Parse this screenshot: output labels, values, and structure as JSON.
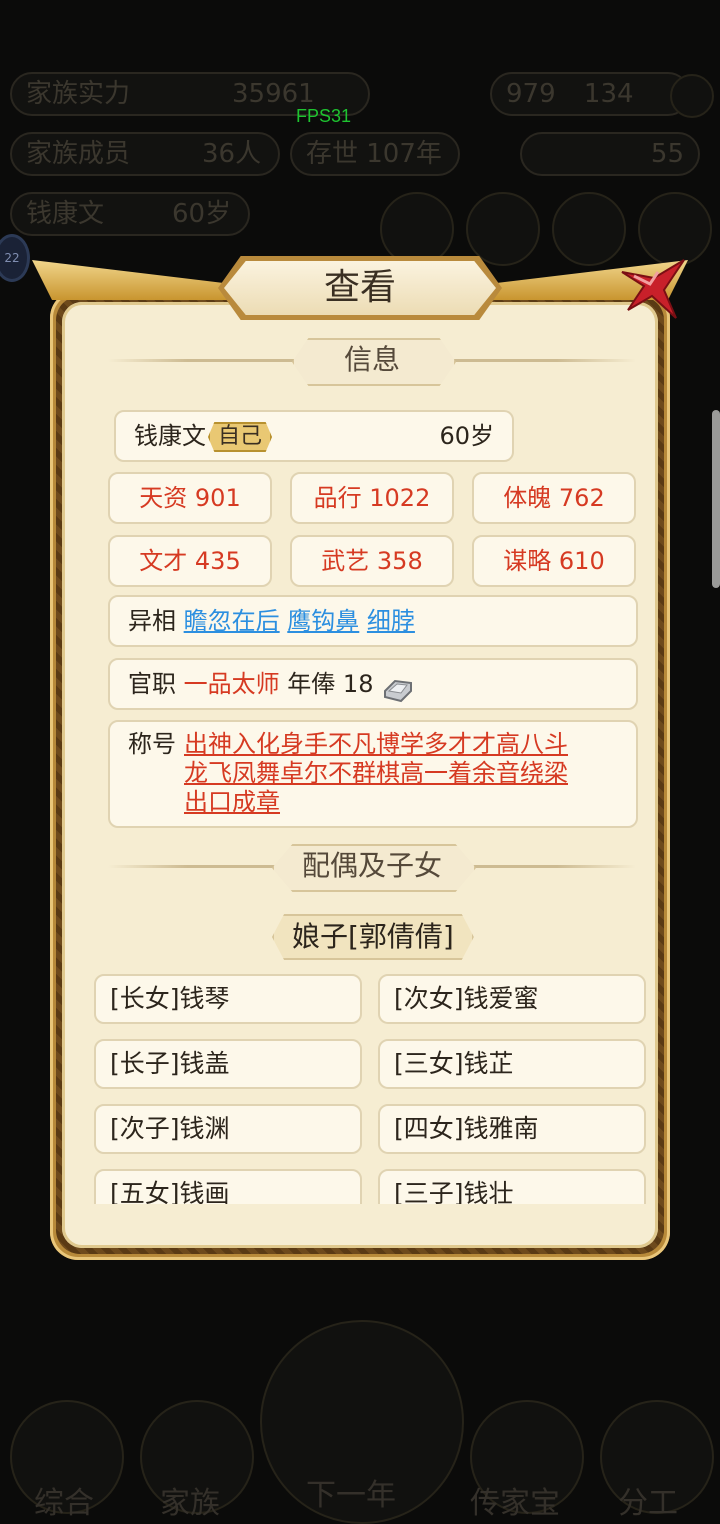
{
  "background": {
    "fps": "FPS31",
    "badge": "22",
    "row1": {
      "label": "家族实力",
      "value": "35961",
      "count": "979",
      "sub": "134"
    },
    "row2": {
      "label": "家族成员",
      "value": "36人",
      "tag": "存世 107年",
      "coins": "55"
    },
    "row3": {
      "label": "钱康文",
      "value": "60岁"
    },
    "bottom_nav": [
      "综合",
      "家族",
      "下一年",
      "传家宝",
      "分工"
    ]
  },
  "dialog": {
    "title": "查看",
    "close_icon": "close-x-icon",
    "info_section": "信息",
    "person": {
      "name": "钱康文",
      "self_tag": "自己",
      "age": "60岁"
    },
    "stats": [
      {
        "label": "天资 901"
      },
      {
        "label": "品行 1022"
      },
      {
        "label": "体魄 762"
      },
      {
        "label": "文才 435"
      },
      {
        "label": "武艺 358"
      },
      {
        "label": "谋略 610"
      }
    ],
    "appearance": {
      "label": "异相",
      "traits": [
        "瞻忽在后",
        "鹰钩鼻",
        "细脖"
      ]
    },
    "office": {
      "label": "官职",
      "rank": "一品太师",
      "salary_label": "年俸",
      "salary": "18",
      "salary_icon": "silver-ingot-icon"
    },
    "titles": {
      "label": "称号",
      "lines": [
        "出神入化身手不凡博学多才才高八斗",
        "龙飞凤舞卓尔不群棋高一着余音绕梁",
        "出口成章"
      ]
    },
    "family_section": "配偶及子女",
    "spouse": "娘子[郭倩倩]",
    "children": [
      {
        "name": "[长女]钱琴"
      },
      {
        "name": "[次女]钱爱蜜"
      },
      {
        "name": "[长子]钱盖"
      },
      {
        "name": "[三女]钱芷"
      },
      {
        "name": "[次子]钱渊"
      },
      {
        "name": "[四女]钱雅南"
      },
      {
        "name": "[五女]钱画"
      },
      {
        "name": "[三子]钱壮"
      }
    ]
  },
  "colors": {
    "accent_red": "#d63a22",
    "link_blue": "#2c8fe0",
    "panel": "#f6edd2",
    "frame": "#b88a3a"
  }
}
